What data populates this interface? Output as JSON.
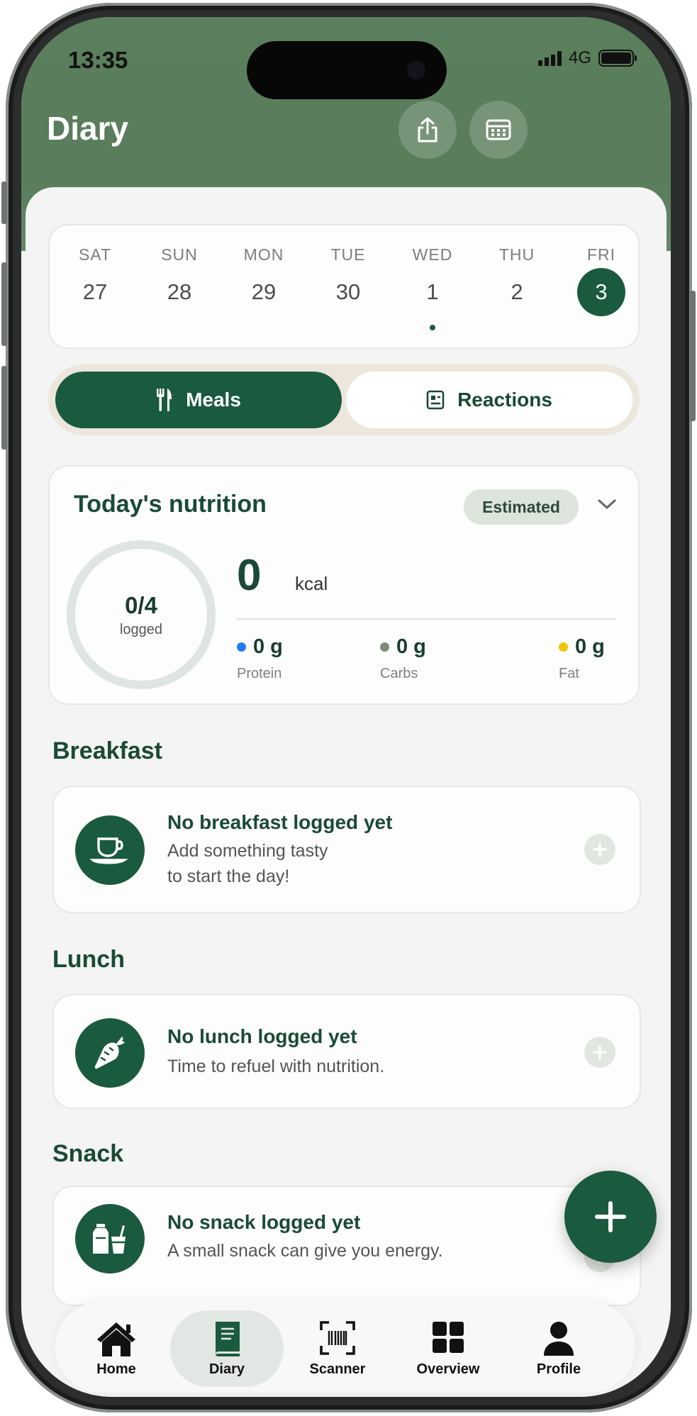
{
  "status_bar": {
    "time": "13:35",
    "network": "4G"
  },
  "header": {
    "title": "Diary"
  },
  "week": {
    "days": [
      {
        "name": "SAT",
        "num": "27"
      },
      {
        "name": "SUN",
        "num": "28"
      },
      {
        "name": "MON",
        "num": "29"
      },
      {
        "name": "TUE",
        "num": "30"
      },
      {
        "name": "WED",
        "num": "1"
      },
      {
        "name": "THU",
        "num": "2"
      },
      {
        "name": "FRI",
        "num": "3"
      }
    ],
    "selected": "FRI",
    "marked": "WED"
  },
  "segment": {
    "meals": "Meals",
    "reactions": "Reactions",
    "selected": "Meals"
  },
  "nutrition": {
    "title": "Today's nutrition",
    "badge": "Estimated",
    "ring_value": "0/4",
    "ring_label": "logged",
    "kcal_value": "0",
    "kcal_unit": "kcal",
    "macros": [
      {
        "value": "0 g",
        "label": "Protein",
        "color": "#1e7ef0"
      },
      {
        "value": "0 g",
        "label": "Carbs",
        "color": "#7d8c7b"
      },
      {
        "value": "0 g",
        "label": "Fat",
        "color": "#f0c400"
      }
    ]
  },
  "meals": {
    "breakfast": {
      "section": "Breakfast",
      "title": "No breakfast logged yet",
      "sub1": "Add something tasty",
      "sub2": "to start the day!",
      "icon": "coffee-cup-icon"
    },
    "lunch": {
      "section": "Lunch",
      "title": "No lunch logged yet",
      "sub1": "Time to refuel with nutrition.",
      "icon": "carrot-icon"
    },
    "snack": {
      "section": "Snack",
      "title": "No snack logged yet",
      "sub1": "A small snack can give you energy.",
      "icon": "snack-icon"
    }
  },
  "tabbar": {
    "items": [
      {
        "label": "Home",
        "icon": "home-icon"
      },
      {
        "label": "Diary",
        "icon": "book-icon"
      },
      {
        "label": "Scanner",
        "icon": "barcode-scan-icon"
      },
      {
        "label": "Overview",
        "icon": "grid-icon"
      },
      {
        "label": "Profile",
        "icon": "person-icon"
      }
    ],
    "active": "Diary"
  },
  "colors": {
    "brand": "#1a5a3f",
    "header": "#5a7d5b",
    "background": "#f3f4f3"
  }
}
